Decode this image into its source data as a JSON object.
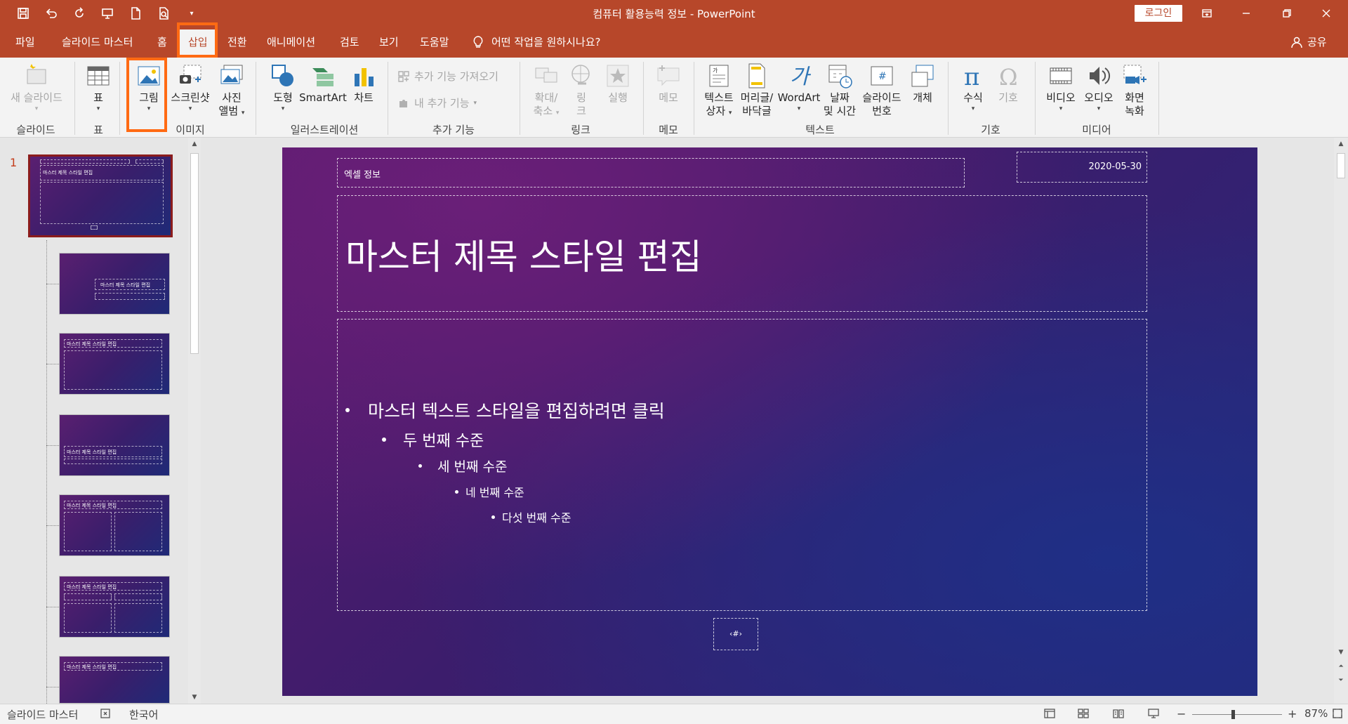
{
  "titlebar": {
    "title": "컴퓨터 활용능력 정보  -  PowerPoint",
    "login": "로그인"
  },
  "tabs": {
    "file": "파일",
    "slide_master": "슬라이드 마스터",
    "home": "홈",
    "insert": "삽입",
    "transitions": "전환",
    "animations": "애니메이션",
    "review": "검토",
    "view": "보기",
    "help": "도움말",
    "tell_me": "어떤 작업을 원하시나요?",
    "share": "공유"
  },
  "ribbon": {
    "new_slide": "새 슬라이드",
    "table": "표",
    "picture": "그림",
    "screenshot": "스크린샷",
    "photo_album_1": "사진",
    "photo_album_2": "앨범",
    "shapes": "도형",
    "smartart": "SmartArt",
    "chart": "차트",
    "get_addins": "추가 기능 가져오기",
    "my_addins": "내 추가 기능",
    "zoom_1": "확대/",
    "zoom_2": "축소",
    "link_1": "링",
    "link_2": "크",
    "action": "실행",
    "comment": "메모",
    "textbox_1": "텍스트",
    "textbox_2": "상자",
    "header_1": "머리글/",
    "header_2": "바닥글",
    "wordart": "WordArt",
    "datetime_1": "날짜",
    "datetime_2": "및 시간",
    "slidenum_1": "슬라이드",
    "slidenum_2": "번호",
    "object": "개체",
    "equation": "수식",
    "symbol": "기호",
    "video": "비디오",
    "audio": "오디오",
    "screenrec_1": "화면",
    "screenrec_2": "녹화",
    "groups": {
      "slides": "슬라이드",
      "tables": "표",
      "images": "이미지",
      "illustrations": "일러스트레이션",
      "addins": "추가 기능",
      "links": "링크",
      "comments": "메모",
      "text": "텍스트",
      "symbols": "기호",
      "media": "미디어"
    }
  },
  "thumbnails": {
    "number": "1",
    "master_title": "마스터 제목 스타일 편집",
    "layout_title": "마스터 제목 스타일 편집"
  },
  "slide": {
    "header": "엑셀 정보",
    "date": "2020-05-30",
    "title": "마스터 제목 스타일 편집",
    "bullets": [
      "마스터 텍스트 스타일을 편집하려면 클릭",
      "두 번째 수준",
      "세 번째 수준",
      "네 번째 수준",
      "다섯 번째 수준"
    ],
    "slide_number": "‹#›"
  },
  "status": {
    "view_name": "슬라이드 마스터",
    "language": "한국어",
    "zoom": "87%",
    "zoom_fraction": 0.45
  },
  "colors": {
    "accent": "#b7472a",
    "highlight": "#ff6a13"
  }
}
